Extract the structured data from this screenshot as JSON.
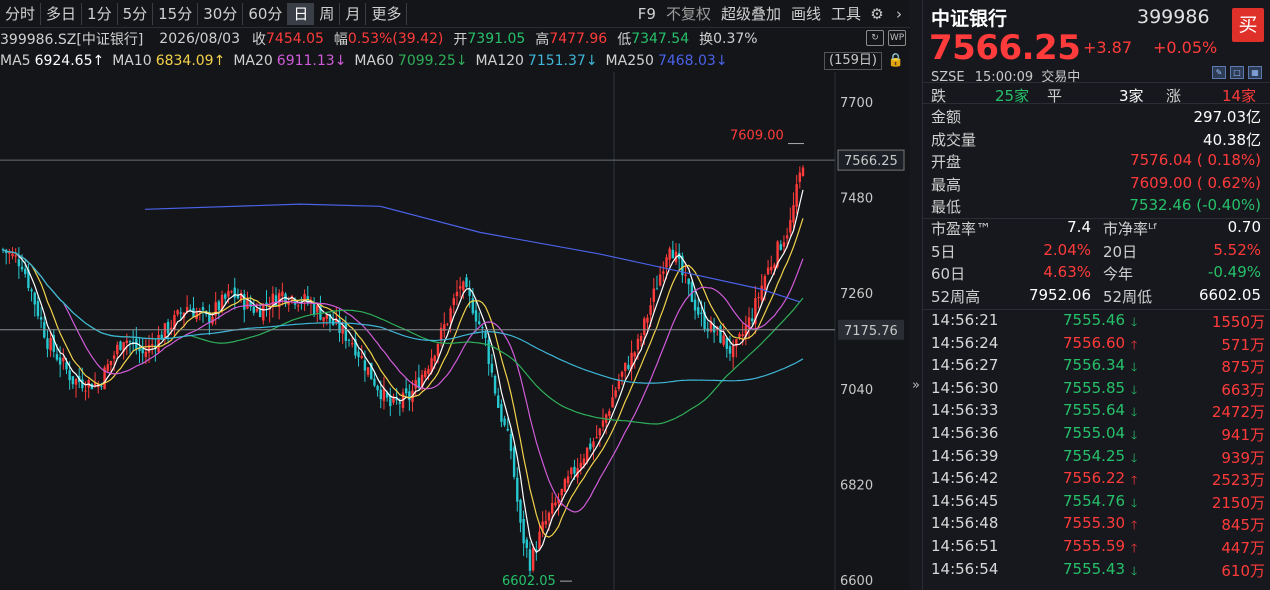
{
  "toolbar": {
    "tabs": [
      "分时",
      "多日",
      "1分",
      "5分",
      "15分",
      "30分",
      "60分",
      "日",
      "周",
      "月",
      "更多"
    ],
    "active_tab": "日",
    "tools": [
      "F9",
      "不复权",
      "超级叠加",
      "画线",
      "工具"
    ],
    "gear_icon": "gear-icon",
    "collapse_icon": "chevron-right-icon"
  },
  "info": {
    "code_name": "399986.SZ[中证银行]",
    "date": "2026/08/03",
    "close_label": "收",
    "close": "7454.05",
    "amp_label": "幅",
    "amp": "0.53%(39.42)",
    "open_label": "开",
    "open": "7391.05",
    "high_label": "高",
    "high": "7477.96",
    "low_label": "低",
    "low": "7347.54",
    "turnover_label": "换",
    "turnover": "0.37%"
  },
  "ma": [
    {
      "label": "MA5",
      "value": "6924.65↑",
      "color": "#ffffff"
    },
    {
      "label": "MA10",
      "value": "6834.09↑",
      "color": "#f2d24b"
    },
    {
      "label": "MA20",
      "value": "6911.13↓",
      "color": "#d05bd8"
    },
    {
      "label": "MA60",
      "value": "7099.25↓",
      "color": "#2fae5a"
    },
    {
      "label": "MA120",
      "value": "7151.37↓",
      "color": "#3fb6d8"
    },
    {
      "label": "MA250",
      "value": "7468.03↓",
      "color": "#4a62e8"
    }
  ],
  "period_label": "(159日)",
  "chart_data": {
    "type": "candlestick",
    "y_ticks": [
      7700,
      7480,
      7260,
      7040,
      6820,
      6600
    ],
    "ylim": [
      6600,
      7700
    ],
    "current_price_label": "7566.25",
    "ref_price_label": "7175.76",
    "high_mark": "7609.00",
    "low_mark": "6602.05",
    "colors": {
      "up": "#ff3b3b",
      "down": "#27c7d0",
      "ma5": "#ffffff",
      "ma10": "#f2d24b",
      "ma20": "#d05bd8",
      "ma60": "#2fae5a",
      "ma120": "#3fb6d8",
      "ma250": "#4a62e8"
    }
  },
  "quote": {
    "name": "中证银行",
    "code": "399986",
    "buy": "买",
    "price": "7566.25",
    "change": "+3.87",
    "change_pct": "+0.05%",
    "exchange": "SZSE",
    "time": "15:00:09",
    "status": "交易中",
    "breadth": {
      "down_label": "跌",
      "down": "25家",
      "flat_label": "平",
      "flat": "3家",
      "up_label": "涨",
      "up": "14家"
    },
    "stats": [
      {
        "k": "金额",
        "v": "297.03亿",
        "c": "white"
      },
      {
        "k": "成交量",
        "v": "40.38亿",
        "c": "white"
      },
      {
        "k": "开盘",
        "v": "7576.04 ( 0.18%)",
        "c": "red"
      },
      {
        "k": "最高",
        "v": "7609.00 ( 0.62%)",
        "c": "red"
      },
      {
        "k": "最低",
        "v": "7532.46 (-0.40%)",
        "c": "green"
      }
    ],
    "stats2": [
      {
        "k1": "市盈率™",
        "v1": "7.4",
        "c1": "white",
        "k2": "市净率ᴸᶠ",
        "v2": "0.70",
        "c2": "white"
      },
      {
        "k1": "5日",
        "v1": "2.04%",
        "c1": "red",
        "k2": "20日",
        "v2": "5.52%",
        "c2": "red"
      },
      {
        "k1": "60日",
        "v1": "4.63%",
        "c1": "red",
        "k2": "今年",
        "v2": "-0.49%",
        "c2": "green"
      },
      {
        "k1": "52周高",
        "v1": "7952.06",
        "c1": "white",
        "k2": "52周低",
        "v2": "6602.05",
        "c2": "white"
      }
    ]
  },
  "ticks": [
    {
      "time": "14:56:21",
      "price": "7555.46",
      "dir": "down",
      "vol": "1550万"
    },
    {
      "time": "14:56:24",
      "price": "7556.60",
      "dir": "up",
      "vol": "571万"
    },
    {
      "time": "14:56:27",
      "price": "7556.34",
      "dir": "down",
      "vol": "875万"
    },
    {
      "time": "14:56:30",
      "price": "7555.85",
      "dir": "down",
      "vol": "663万"
    },
    {
      "time": "14:56:33",
      "price": "7555.64",
      "dir": "down",
      "vol": "2472万"
    },
    {
      "time": "14:56:36",
      "price": "7555.04",
      "dir": "down",
      "vol": "941万"
    },
    {
      "time": "14:56:39",
      "price": "7554.25",
      "dir": "down",
      "vol": "939万"
    },
    {
      "time": "14:56:42",
      "price": "7556.22",
      "dir": "up",
      "vol": "2523万"
    },
    {
      "time": "14:56:45",
      "price": "7554.76",
      "dir": "down",
      "vol": "2150万"
    },
    {
      "time": "14:56:48",
      "price": "7555.30",
      "dir": "up",
      "vol": "845万"
    },
    {
      "time": "14:56:51",
      "price": "7555.59",
      "dir": "up",
      "vol": "447万"
    },
    {
      "time": "14:56:54",
      "price": "7555.43",
      "dir": "down",
      "vol": "610万"
    }
  ]
}
